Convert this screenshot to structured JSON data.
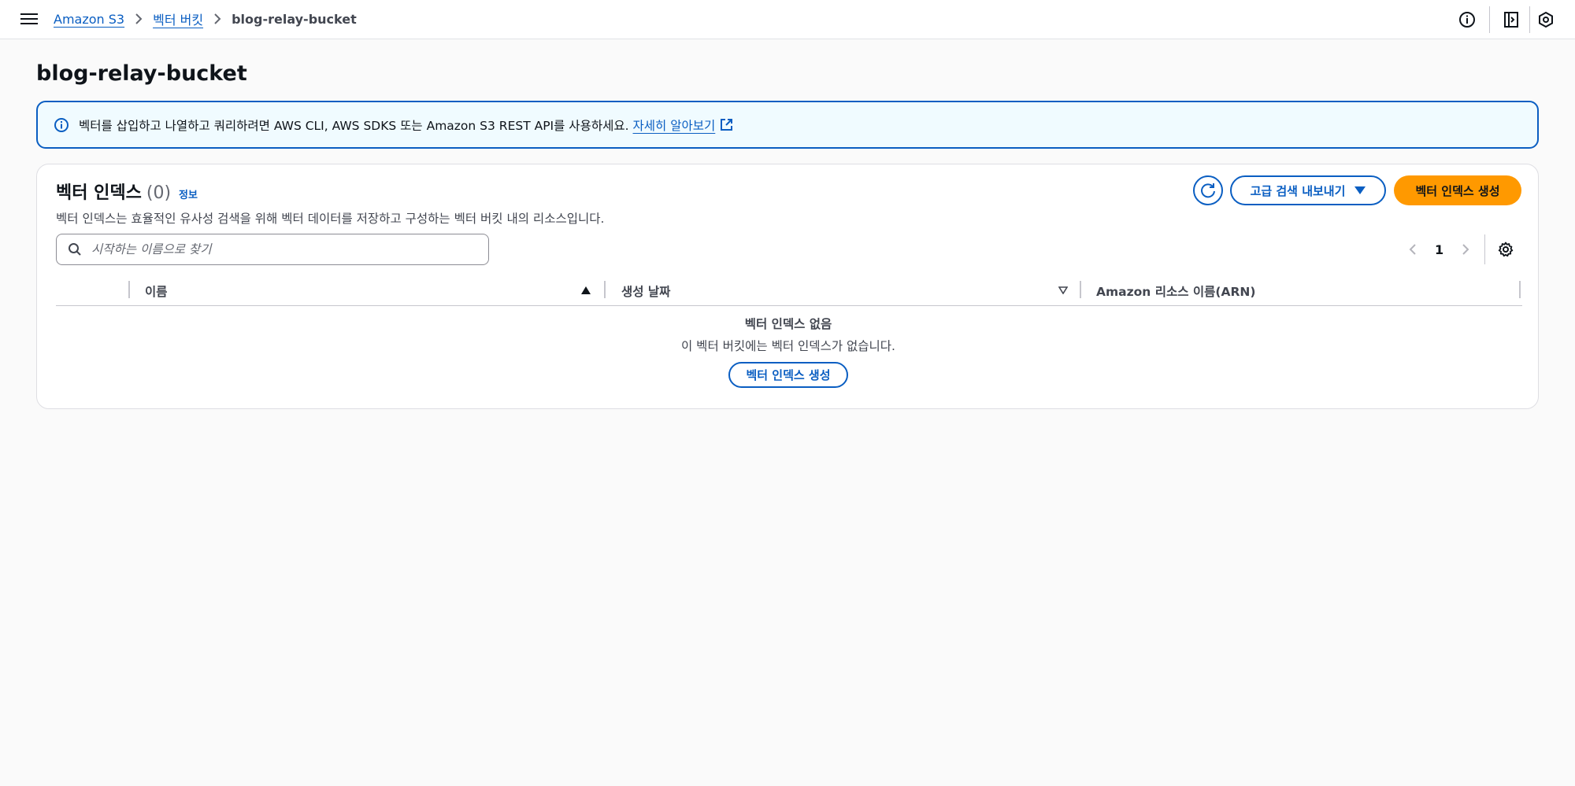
{
  "breadcrumb": {
    "items": [
      "Amazon S3",
      "벡터 버킷"
    ],
    "current": "blog-relay-bucket"
  },
  "page": {
    "title": "blog-relay-bucket"
  },
  "info_banner": {
    "text": "벡터를 삽입하고 나열하고 쿼리하려면 AWS CLI, AWS SDKS 또는 Amazon S3 REST API를 사용하세요.",
    "link": "자세히 알아보기"
  },
  "panel": {
    "title": "벡터 인덱스",
    "count": "(0)",
    "info_link": "정보",
    "description": "벡터 인덱스는 효율적인 유사성 검색을 위해 벡터 데이터를 저장하고 구성하는 벡터 버킷 내의 리소스입니다.",
    "export_button": "고급 검색 내보내기",
    "create_button": "벡터 인덱스 생성"
  },
  "search": {
    "placeholder": "시작하는 이름으로 찾기"
  },
  "pagination": {
    "current_page": "1"
  },
  "table": {
    "columns": [
      "이름",
      "생성 날짜",
      "Amazon 리소스 이름(ARN)"
    ],
    "sort": {
      "column": "이름",
      "direction": "ascending"
    }
  },
  "empty_state": {
    "title": "벡터 인덱스 없음",
    "description": "이 벡터 버킷에는 벡터 인덱스가 없습니다.",
    "button": "벡터 인덱스 생성"
  },
  "icons": {
    "menu": "hamburger-menu-icon",
    "info": "info-circle-icon",
    "side_panel": "side-panel-icon",
    "notifications": "hexagon-settings-icon",
    "external": "external-link-icon",
    "refresh": "refresh-icon",
    "search": "search-icon",
    "settings": "gear-icon"
  },
  "colors": {
    "link": "#0a5ec2",
    "primary_button": "#ff9900",
    "banner_bg": "#f0fbff"
  }
}
